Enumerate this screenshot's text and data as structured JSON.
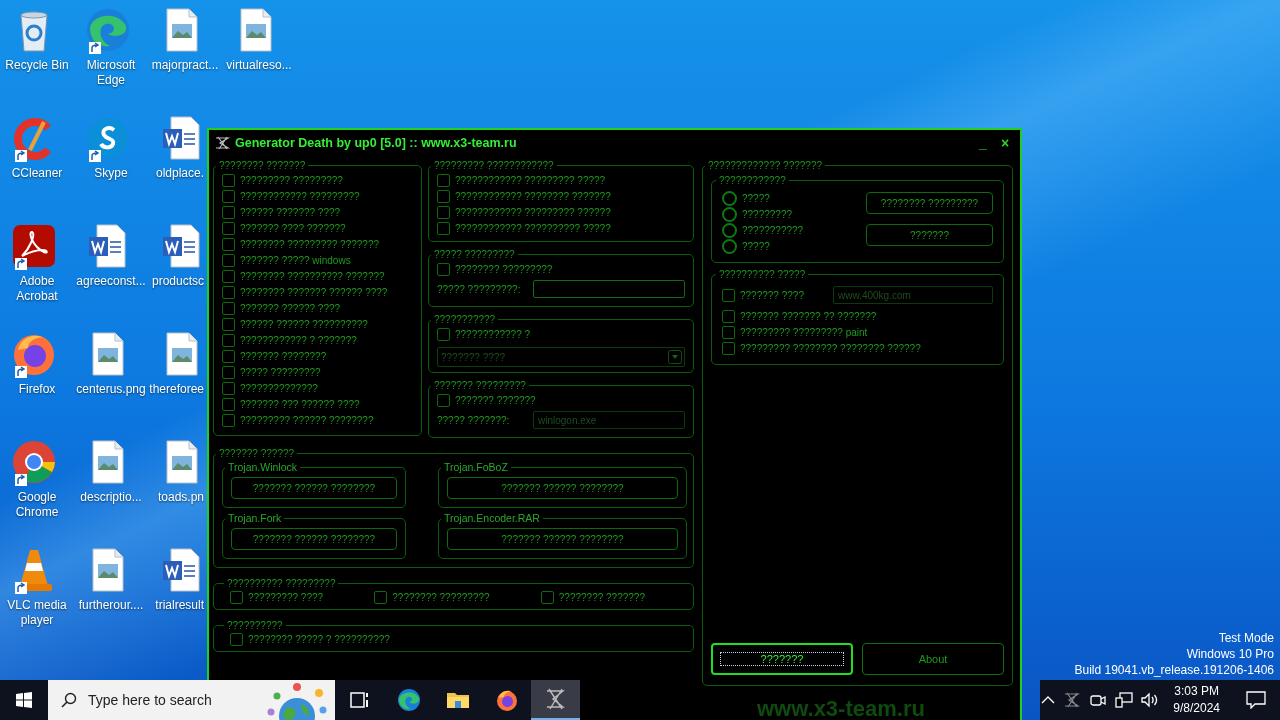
{
  "desktop_icons": [
    {
      "label": "Recycle Bin",
      "kind": "recycle",
      "shortcut": false
    },
    {
      "label": "CCleaner",
      "kind": "ccleaner",
      "shortcut": true
    },
    {
      "label": "Adobe Acrobat",
      "kind": "acrobat",
      "shortcut": true
    },
    {
      "label": "Firefox",
      "kind": "firefox",
      "shortcut": true
    },
    {
      "label": "Google Chrome",
      "kind": "chrome",
      "shortcut": true
    },
    {
      "label": "VLC media player",
      "kind": "vlc",
      "shortcut": true
    },
    {
      "label": "Microsoft Edge",
      "kind": "edge",
      "shortcut": true
    },
    {
      "label": "Skype",
      "kind": "skype",
      "shortcut": true
    },
    {
      "label": "agreeconst...",
      "kind": "word",
      "shortcut": false
    },
    {
      "label": "centerus.png",
      "kind": "image",
      "shortcut": false
    },
    {
      "label": "descriptio...",
      "kind": "image",
      "shortcut": false
    },
    {
      "label": "furtherour....",
      "kind": "image",
      "shortcut": false
    },
    {
      "label": "majorpract...",
      "kind": "image",
      "shortcut": false
    },
    {
      "label": "oldplace.",
      "kind": "word",
      "shortcut": false
    },
    {
      "label": "productsc",
      "kind": "word",
      "shortcut": false
    },
    {
      "label": "thereforee",
      "kind": "image",
      "shortcut": false
    },
    {
      "label": "toads.pn",
      "kind": "image",
      "shortcut": false
    },
    {
      "label": "trialresult",
      "kind": "word",
      "shortcut": false
    },
    {
      "label": "virtualreso...",
      "kind": "image",
      "shortcut": false
    }
  ],
  "window": {
    "title": "Generator Death by up0 [5.0] :: www.x3-team.ru",
    "minimize": "_",
    "close": "×",
    "main_options": {
      "title": "???????? ???????",
      "options": [
        {
          "label": "????????? ?????????",
          "checked": false
        },
        {
          "label": "???????????? ?????????",
          "checked": false
        },
        {
          "label": "?????? ??????? ????",
          "checked": false
        },
        {
          "label": "??????? ???? ???????",
          "checked": false
        },
        {
          "label": "???????? ????????? ???????",
          "checked": false
        },
        {
          "label": "??????? ????? windows",
          "checked": false
        },
        {
          "label": "???????? ?????????? ???????",
          "checked": false
        },
        {
          "label": "???????? ??????? ?????? ????",
          "checked": false
        },
        {
          "label": "??????? ?????? ????",
          "checked": false
        },
        {
          "label": "?????? ?????? ??????????",
          "checked": false
        },
        {
          "label": "???????????? ? ???????",
          "checked": false
        },
        {
          "label": "??????? ????????",
          "checked": false
        },
        {
          "label": "????? ?????????",
          "checked": false
        },
        {
          "label": "??????????????",
          "checked": false
        },
        {
          "label": "??????? ??? ?????? ????",
          "checked": false
        },
        {
          "label": "????????? ?????? ????????",
          "checked": false
        }
      ]
    },
    "middle_groups": [
      {
        "title": "????????? ????????????",
        "options": [
          {
            "label": "???????????? ????????? ?????",
            "checked": false
          },
          {
            "label": "???????????? ???????? ???????",
            "checked": false
          },
          {
            "label": "???????????? ????????? ??????",
            "checked": false
          },
          {
            "label": "???????????? ?????????? ?????",
            "checked": false
          }
        ]
      },
      {
        "title": "????? ?????????",
        "options": [
          {
            "label": "???????? ?????????",
            "checked": false
          }
        ],
        "field": {
          "label": "????? ?????????:",
          "disabled": false
        }
      },
      {
        "title": "???????????",
        "options": [
          {
            "label": "???????????? ?",
            "checked": false
          }
        ],
        "dropdown": {
          "value": "??????? ????",
          "disabled": true
        }
      },
      {
        "title": "??????? ?????????",
        "options": [
          {
            "label": "??????? ???????",
            "checked": false
          }
        ],
        "field": {
          "label": "????? ???????:",
          "value": "winlogon.exe",
          "disabled": true
        }
      }
    ],
    "trojans": {
      "title": "??????? ??????",
      "items": [
        {
          "name": "Trojan.Winlock",
          "button": "??????? ?????? ????????"
        },
        {
          "name": "Trojan.FoBoZ",
          "button": "??????? ?????? ????????"
        },
        {
          "name": "Trojan.Fork",
          "button": "??????? ?????? ????????"
        },
        {
          "name": "Trojan.Encoder.RAR",
          "button": "??????? ?????? ????????"
        }
      ]
    },
    "effects": {
      "title": "?????????? ?????????",
      "options": [
        {
          "label": "????????? ????",
          "checked": false
        },
        {
          "label": "???????? ?????????",
          "checked": false
        },
        {
          "label": "???????? ???????",
          "checked": false
        }
      ]
    },
    "last_group": {
      "title": "??????????",
      "options": [
        {
          "label": "???????? ????? ? ??????????",
          "checked": false
        }
      ]
    },
    "protection": {
      "title": "????????????? ???????",
      "modes": {
        "title": "????????????",
        "options": [
          {
            "label": "?????",
            "selected": false
          },
          {
            "label": "?????????",
            "selected": false
          },
          {
            "label": "???????????",
            "selected": false
          },
          {
            "label": "?????",
            "selected": false
          }
        ],
        "buttons": [
          "???????? ?????????",
          "???????"
        ]
      },
      "extras": {
        "title": "?????????? ?????",
        "options": [
          {
            "label": "??????? ????",
            "checked": false,
            "field": {
              "value": "www.400kg.com",
              "disabled": true
            }
          },
          {
            "label": "??????? ??????? ?? ???????",
            "checked": false
          },
          {
            "label": "????????? ????????? paint",
            "checked": false
          },
          {
            "label": "????????? ???????? ???????? ??????",
            "checked": false
          }
        ]
      },
      "buttons": [
        {
          "label": "???????",
          "focused": true
        },
        {
          "label": "About",
          "focused": false
        }
      ]
    },
    "footer": "www.x3-team.ru"
  },
  "system_notice": [
    "Test Mode",
    "Windows 10 Pro",
    "Build 19041.vb_release.191206-1406"
  ],
  "taskbar": {
    "search": {
      "placeholder": "Type here to search"
    },
    "apps": [
      {
        "kind": "taskview",
        "selected": false
      },
      {
        "kind": "edge",
        "selected": false
      },
      {
        "kind": "folder",
        "selected": false
      },
      {
        "kind": "firefox",
        "selected": false
      },
      {
        "kind": "x3",
        "selected": true
      }
    ],
    "time": "3:03 PM",
    "date": "9/8/2024"
  }
}
